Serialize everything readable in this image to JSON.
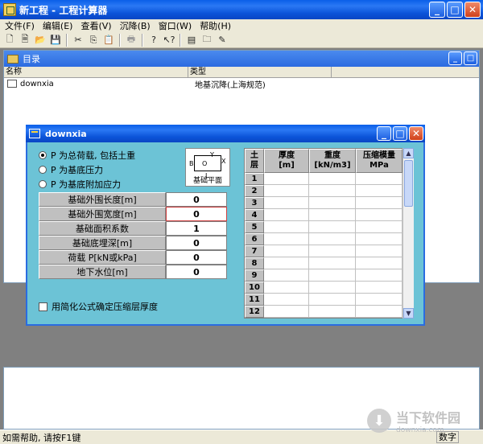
{
  "window": {
    "title": "新工程 - 工程计算器"
  },
  "menu": [
    "文件(F)",
    "编辑(E)",
    "查看(V)",
    "沉降(B)",
    "窗口(W)",
    "帮助(H)"
  ],
  "toolbar_icons": [
    "new-icon",
    "new-doc-icon",
    "open-icon",
    "save-icon",
    "cut-icon",
    "copy-icon",
    "paste-icon",
    "print-icon",
    "help-icon",
    "context-help-icon",
    "tile-icon",
    "folder-view-icon",
    "settings-icon"
  ],
  "directory": {
    "title": "目录",
    "columns": [
      "名称",
      "类型"
    ],
    "rows": [
      {
        "name": "downxia",
        "type": "地基沉降(上海规范)"
      }
    ]
  },
  "dialog": {
    "title": "downxia",
    "radios": [
      {
        "label": "P 为总荷载, 包括土重",
        "checked": true
      },
      {
        "label": "P 为基底压力",
        "checked": false
      },
      {
        "label": "P 为基底附加应力",
        "checked": false
      }
    ],
    "diagram": {
      "b": "B",
      "o": "O",
      "y": "Y",
      "x": "X",
      "l": "L",
      "caption": "基础平面"
    },
    "params": [
      {
        "label": "基础外围长度[m]",
        "value": "0"
      },
      {
        "label": "基础外围宽度[m]",
        "value": "0"
      },
      {
        "label": "基础面积系数",
        "value": "1"
      },
      {
        "label": "基础底埋深[m]",
        "value": "0"
      },
      {
        "label": "荷载 P[kN或kPa]",
        "value": "0"
      },
      {
        "label": "地下水位[m]",
        "value": "0"
      }
    ],
    "checkbox_label": "用简化公式确定压缩层厚度",
    "grid": {
      "headers": [
        {
          "line1": "土",
          "line2": "层"
        },
        {
          "line1": "厚度",
          "line2": "[m]"
        },
        {
          "line1": "重度",
          "line2": "[kN/m3]"
        },
        {
          "line1": "压缩模量",
          "line2": "MPa"
        }
      ],
      "rows": [
        "1",
        "2",
        "3",
        "4",
        "5",
        "6",
        "7",
        "8",
        "9",
        "10",
        "11",
        "12"
      ]
    }
  },
  "status": {
    "text": "如需帮助, 请按F1键",
    "mode": "数字"
  },
  "watermark": {
    "brand": "当下软件园",
    "url": "downxia.com"
  },
  "colors": {
    "titlebar": "#0a5fe8",
    "dialog_bg": "#6cc3d6",
    "active_border": "#d04040"
  }
}
